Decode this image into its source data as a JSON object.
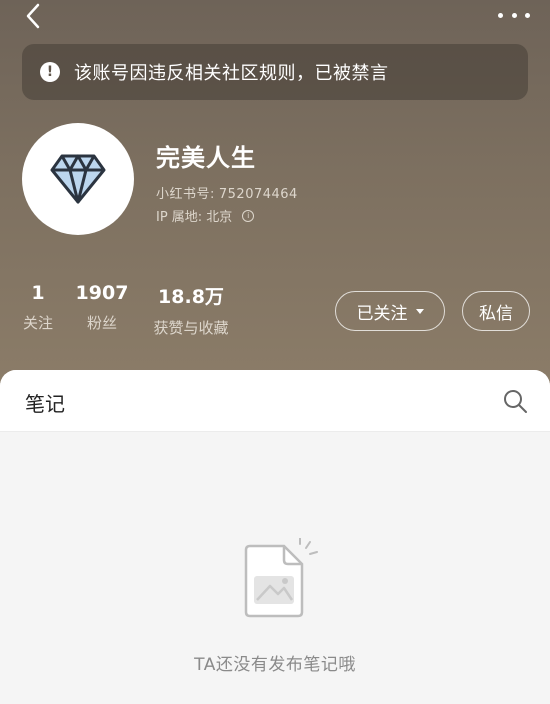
{
  "notice": {
    "text": "该账号因违反相关社区规则，已被禁言",
    "icon": "exclamation-icon"
  },
  "profile": {
    "name": "完美人生",
    "id_label": "小红书号:",
    "id_value": "752074464",
    "ip_label": "IP 属地:",
    "ip_value": "北京"
  },
  "stats": [
    {
      "value": "1",
      "label": "关注"
    },
    {
      "value": "1907",
      "label": "粉丝"
    },
    {
      "value": "18.8万",
      "label": "获赞与收藏"
    }
  ],
  "actions": {
    "follow_label": "已关注",
    "message_label": "私信"
  },
  "tabs": {
    "notes_label": "笔记"
  },
  "empty": {
    "text": "TA还没有发布笔记哦"
  },
  "colors": {
    "header_bg": "#7a6d5e",
    "content_bg": "#f5f5f5",
    "text_muted": "#8a8a8a"
  }
}
